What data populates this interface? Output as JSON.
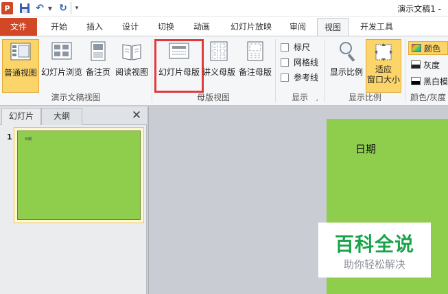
{
  "title_bar": {
    "app_icon": "P",
    "document_title": "演示文稿1 -",
    "icons": [
      "powerpoint-icon",
      "save-icon",
      "undo-icon",
      "redo-icon",
      "customize-icon"
    ]
  },
  "tabs": [
    {
      "label": "文件",
      "type": "file"
    },
    {
      "label": "开始"
    },
    {
      "label": "插入"
    },
    {
      "label": "设计"
    },
    {
      "label": "切换"
    },
    {
      "label": "动画"
    },
    {
      "label": "幻灯片放映"
    },
    {
      "label": "审阅"
    },
    {
      "label": "视图",
      "active": true
    },
    {
      "label": "开发工具"
    }
  ],
  "ribbon": {
    "groups": {
      "presentation_views": {
        "label": "演示文稿视图",
        "buttons": [
          "普通视图",
          "幻灯片浏览",
          "备注页",
          "阅读视图"
        ]
      },
      "master_views": {
        "label": "母版视图",
        "buttons": [
          "幻灯片母版",
          "讲义母版",
          "备注母版"
        ]
      },
      "show": {
        "label": "显示",
        "checkboxes": [
          "标尺",
          "网格线",
          "参考线"
        ]
      },
      "zoom": {
        "label": "显示比例",
        "buttons": [
          "显示比例",
          "适应",
          "窗口大小"
        ]
      },
      "color": {
        "label": "颜色/灰度",
        "items": [
          "颜色",
          "灰度",
          "黑白模式"
        ]
      }
    }
  },
  "left_panel": {
    "tabs": [
      "幻灯片",
      "大纲"
    ],
    "slide_number": "1",
    "thumb_text": "日期",
    "close_glyph": "✕"
  },
  "slide": {
    "text": "日期",
    "background": "#8fce4d"
  },
  "watermark": {
    "title": "百科全说",
    "subtitle": "助你轻松解决"
  },
  "colors": {
    "file_tab": "#d24726",
    "selected": "#fbd46a",
    "highlight": "#e0393e",
    "slide_green": "#8fce4d"
  }
}
